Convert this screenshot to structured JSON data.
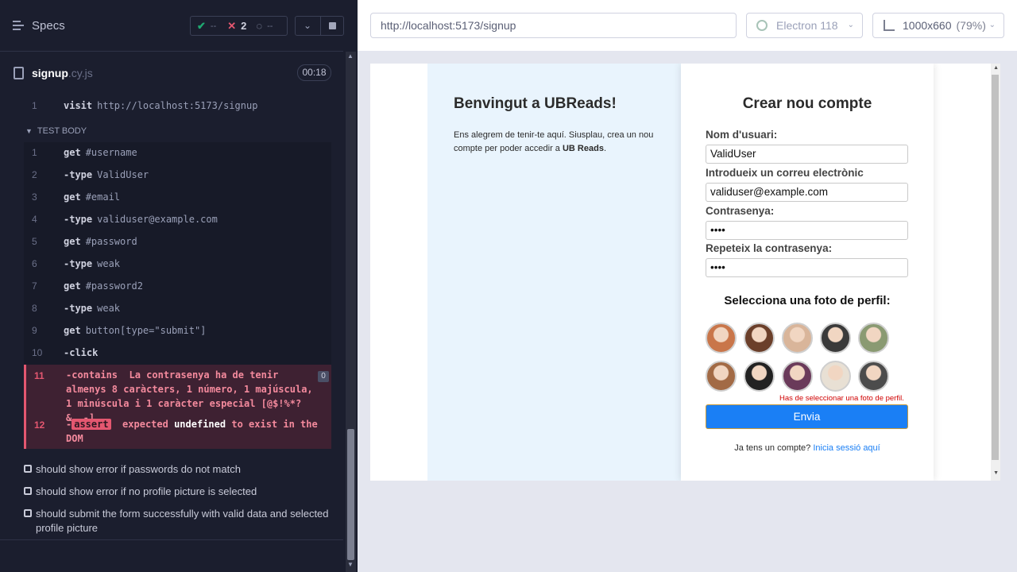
{
  "runner": {
    "specs_label": "Specs",
    "stats": {
      "passed_icon": "check-icon",
      "passed": "--",
      "failed_icon": "x-icon",
      "failed": "2",
      "pending_icon": "spinner-icon",
      "pending": "--"
    },
    "file": {
      "name": "signup",
      "ext": ".cy.js",
      "duration": "00:18"
    },
    "visit": {
      "line": "1",
      "command": "visit",
      "arg": "http://localhost:5173/signup"
    },
    "test_body_label": "TEST BODY",
    "commands": [
      {
        "line": "1",
        "command": "get",
        "arg": "#username"
      },
      {
        "line": "2",
        "command": "-type",
        "arg": "ValidUser"
      },
      {
        "line": "3",
        "command": "get",
        "arg": "#email"
      },
      {
        "line": "4",
        "command": "-type",
        "arg": "validuser@example.com"
      },
      {
        "line": "5",
        "command": "get",
        "arg": "#password"
      },
      {
        "line": "6",
        "command": "-type",
        "arg": "weak"
      },
      {
        "line": "7",
        "command": "get",
        "arg": "#password2"
      },
      {
        "line": "8",
        "command": "-type",
        "arg": "weak"
      },
      {
        "line": "9",
        "command": "get",
        "arg": "button[type=\"submit\"]"
      },
      {
        "line": "10",
        "command": "-click",
        "arg": ""
      }
    ],
    "failed_commands": [
      {
        "line": "11",
        "command": "-contains",
        "text": "La contrasenya ha de tenir almenys 8 caràcters, 1 número, 1 majúscula, 1 minúscula i 1 caràcter especial [@$!%*?&_.-].",
        "badge": "0"
      },
      {
        "line": "12",
        "command": "-",
        "tag": "assert",
        "expected_word": "expected",
        "value": "undefined",
        "rest": "to exist in the DOM"
      }
    ],
    "other_tests": [
      "should show error if passwords do not match",
      "should show error if no profile picture is selected",
      "should submit the form successfully with valid data and selected profile picture"
    ]
  },
  "browser": {
    "url": "http://localhost:5173/signup",
    "name": "Electron 118",
    "viewport": "1000x660",
    "zoom": "(79%)"
  },
  "app": {
    "welcome_title": "Benvingut a UBReads!",
    "welcome_text": "Ens alegrem de tenir-te aquí. Siusplau, crea un nou compte per poder accedir a",
    "welcome_brand": "UB Reads",
    "welcome_end": ".",
    "form_title": "Crear nou compte",
    "fields": [
      {
        "label": "Nom d'usuari:",
        "value": "ValidUser"
      },
      {
        "label": "Introdueix un correu electrònic",
        "value": "validuser@example.com"
      },
      {
        "label": "Contrasenya:",
        "value": "••••"
      },
      {
        "label": "Repeteix la contrasenya:",
        "value": "••••"
      }
    ],
    "picture_title": "Selecciona una foto de perfil:",
    "avatars": [
      {
        "color": "#c9764a",
        "icon": "avatar-1"
      },
      {
        "color": "#6b3f2a",
        "icon": "avatar-2"
      },
      {
        "color": "#d9b59a",
        "icon": "avatar-3"
      },
      {
        "color": "#3a3a3a",
        "icon": "avatar-4"
      },
      {
        "color": "#8a9a72",
        "icon": "avatar-5"
      },
      {
        "color": "#a26a45",
        "icon": "avatar-6"
      },
      {
        "color": "#222222",
        "icon": "avatar-7"
      },
      {
        "color": "#6a3a5a",
        "icon": "avatar-8"
      },
      {
        "color": "#e8e0d4",
        "icon": "avatar-9"
      },
      {
        "color": "#4c4c4c",
        "icon": "avatar-10"
      }
    ],
    "picture_error": "Has de seleccionar una foto de perfil.",
    "submit_label": "Envia",
    "login_prompt": "Ja tens un compte?",
    "login_link": "Inicia sessió aquí"
  },
  "colors": {
    "runner_bg": "#1b1e2e",
    "fail": "#e45770",
    "pass": "#1fa971",
    "accent_blue": "#1a7ff5",
    "error_red": "#d00000"
  }
}
